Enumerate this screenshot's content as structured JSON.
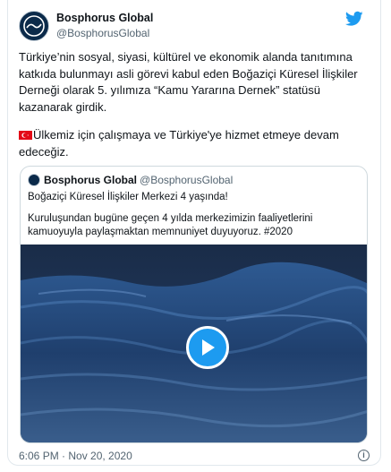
{
  "tweet": {
    "author_name": "Bosphorus Global",
    "author_handle": "@BosphorusGlobal",
    "paragraph1": "Türkiye’nin sosyal, siyasi, kültürel ve ekonomik alanda tanıtımına katkıda bulunmayı asli görevi kabul eden Boğaziçi Küresel İlişkiler Derneği olarak 5. yılımıza “Kamu Yararına Dernek” statüsü kazanarak girdik.",
    "paragraph2": "Ülkemiz için çalışmaya ve Türkiye'ye hizmet etmeye devam edeceğiz.",
    "timestamp": "6:06 PM · Nov 20, 2020"
  },
  "quote": {
    "author_name": "Bosphorus Global",
    "author_handle": "@BosphorusGlobal",
    "line1": "Boğaziçi Küresel İlişkiler Merkezi 4 yaşında!",
    "line2": "Kuruluşundan bugüne geçen 4 yılda merkezimizin faaliyetlerini kamuoyuyla paylaşmaktan memnuniyet duyuyoruz.  #2020"
  },
  "icons": {
    "logo": "twitter-bird-icon",
    "info": "info-icon",
    "play": "play-icon",
    "flag": "turkey-flag-icon"
  },
  "colors": {
    "accent": "#1d9bf0",
    "secondary_text": "#536471",
    "video_sea": "#1d3a63"
  }
}
